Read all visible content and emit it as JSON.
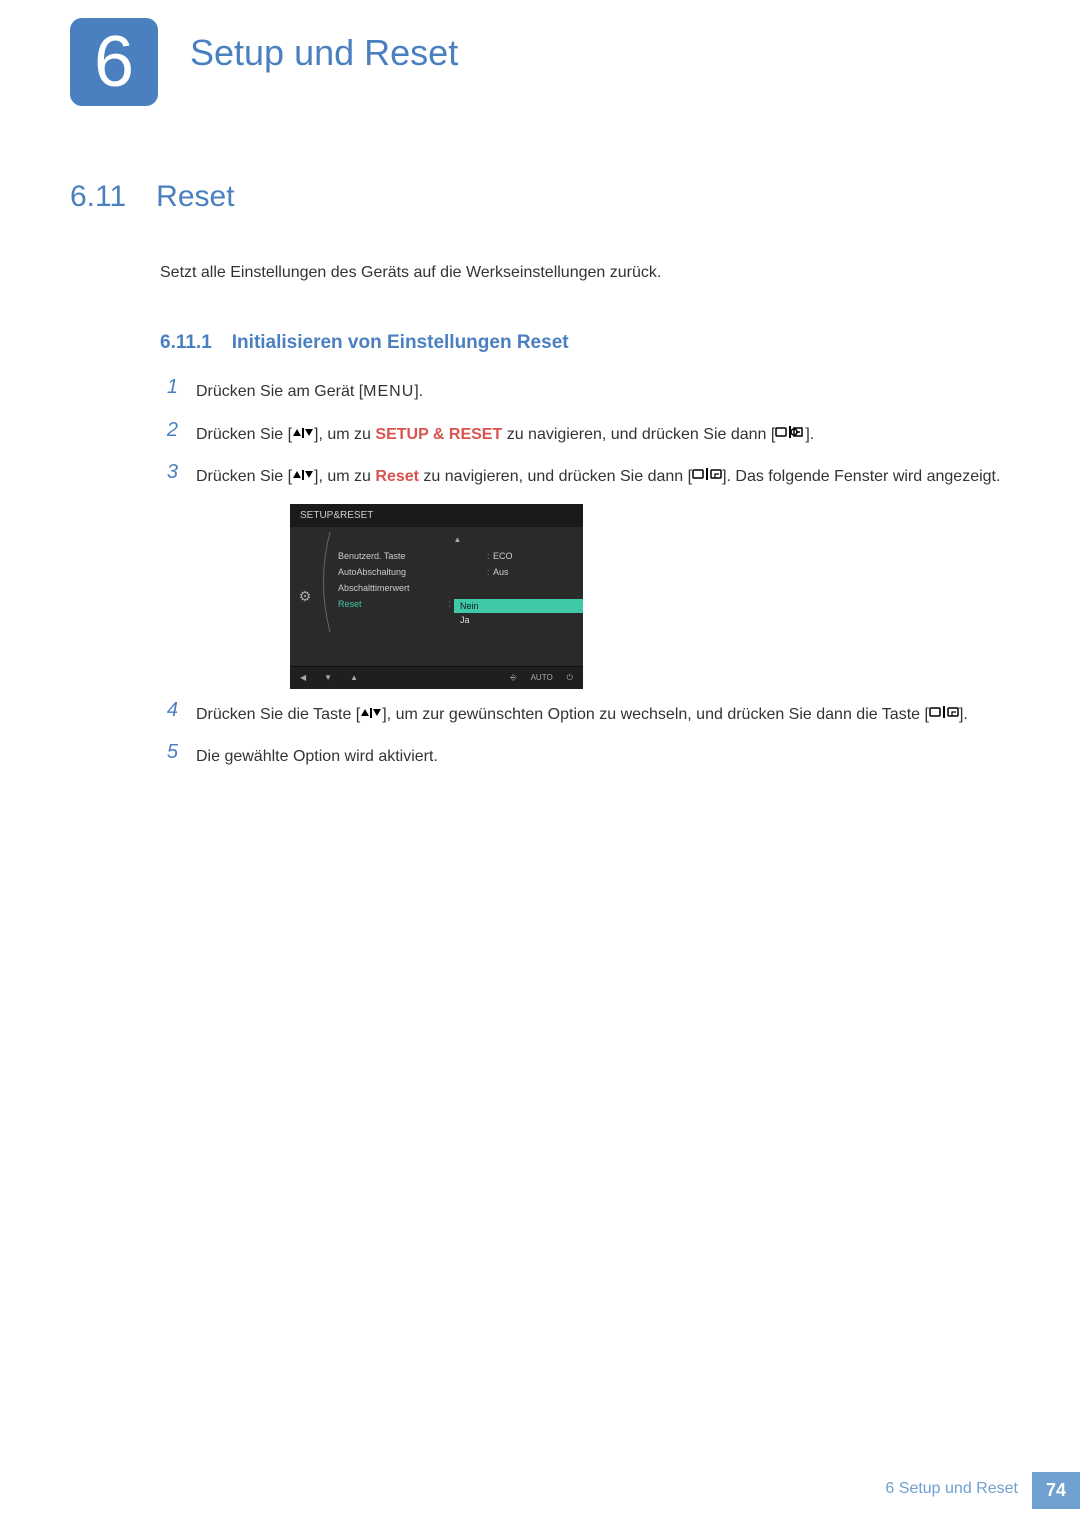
{
  "chapter": {
    "number": "6",
    "title": "Setup und Reset"
  },
  "section": {
    "number": "6.11",
    "title": "Reset"
  },
  "intro": "Setzt alle Einstellungen des Geräts auf die Werkseinstellungen zurück.",
  "subsection": {
    "number": "6.11.1",
    "title": "Initialisieren von Einstellungen Reset"
  },
  "steps": {
    "s1": {
      "num": "1",
      "t1": "Drücken Sie am Gerät [",
      "menu": "MENU",
      "t2": "]."
    },
    "s2": {
      "num": "2",
      "t1": "Drücken Sie [",
      "t2": "], um zu ",
      "bold": "SETUP & RESET",
      "t3": " zu navigieren, und drücken Sie dann [",
      "t4": "]."
    },
    "s3": {
      "num": "3",
      "t1": "Drücken Sie [",
      "t2": "], um zu ",
      "bold": "Reset",
      "t3": " zu navigieren, und drücken Sie dann [",
      "t4": "]. Das folgende Fenster wird angezeigt."
    },
    "s4": {
      "num": "4",
      "t1": "Drücken Sie die Taste [",
      "t2": "], um zur gewünschten Option zu wechseln, und drücken Sie dann die Taste [",
      "t3": "]."
    },
    "s5": {
      "num": "5",
      "text": "Die gewählte Option wird aktiviert."
    }
  },
  "osd": {
    "title": "SETUP&RESET",
    "items": [
      {
        "label": "Benutzerd. Taste",
        "value": "ECO"
      },
      {
        "label": "AutoAbschaltung",
        "value": "Aus"
      },
      {
        "label": "Abschalttimerwert",
        "value": ""
      }
    ],
    "reset": {
      "label": "Reset",
      "sep": ":",
      "options": {
        "no": "Nein",
        "yes": "Ja"
      }
    },
    "bottom": {
      "auto": "AUTO"
    }
  },
  "footer": {
    "text": "6 Setup und Reset",
    "page": "74"
  }
}
